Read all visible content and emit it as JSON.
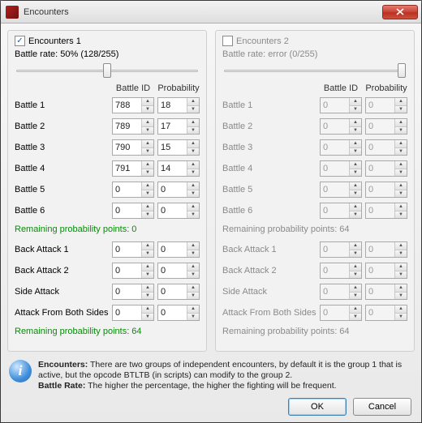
{
  "window": {
    "title": "Encounters"
  },
  "left": {
    "checkbox_label": "Encounters 1",
    "checked": true,
    "rate_label": "Battle rate: 50% (128/255)",
    "slider_percent": 50,
    "col_id": "Battle ID",
    "col_prob": "Probability",
    "battles": [
      {
        "label": "Battle 1",
        "id": "788",
        "prob": "18"
      },
      {
        "label": "Battle 2",
        "id": "789",
        "prob": "17"
      },
      {
        "label": "Battle 3",
        "id": "790",
        "prob": "15"
      },
      {
        "label": "Battle 4",
        "id": "791",
        "prob": "14"
      },
      {
        "label": "Battle 5",
        "id": "0",
        "prob": "0"
      },
      {
        "label": "Battle 6",
        "id": "0",
        "prob": "0"
      }
    ],
    "remaining1": "Remaining probability points: 0",
    "extras": [
      {
        "label": "Back Attack 1",
        "id": "0",
        "prob": "0"
      },
      {
        "label": "Back Attack 2",
        "id": "0",
        "prob": "0"
      },
      {
        "label": "Side Attack",
        "id": "0",
        "prob": "0"
      },
      {
        "label": "Attack From Both Sides",
        "id": "0",
        "prob": "0"
      }
    ],
    "remaining2": "Remaining probability points: 64"
  },
  "right": {
    "checkbox_label": "Encounters 2",
    "checked": false,
    "rate_label": "Battle rate: error (0/255)",
    "slider_percent": 100,
    "col_id": "Battle ID",
    "col_prob": "Probability",
    "battles": [
      {
        "label": "Battle 1",
        "id": "0",
        "prob": "0"
      },
      {
        "label": "Battle 2",
        "id": "0",
        "prob": "0"
      },
      {
        "label": "Battle 3",
        "id": "0",
        "prob": "0"
      },
      {
        "label": "Battle 4",
        "id": "0",
        "prob": "0"
      },
      {
        "label": "Battle 5",
        "id": "0",
        "prob": "0"
      },
      {
        "label": "Battle 6",
        "id": "0",
        "prob": "0"
      }
    ],
    "remaining1": "Remaining probability points: 64",
    "extras": [
      {
        "label": "Back Attack 1",
        "id": "0",
        "prob": "0"
      },
      {
        "label": "Back Attack 2",
        "id": "0",
        "prob": "0"
      },
      {
        "label": "Side Attack",
        "id": "0",
        "prob": "0"
      },
      {
        "label": "Attack From Both Sides",
        "id": "0",
        "prob": "0"
      }
    ],
    "remaining2": "Remaining probability points: 64"
  },
  "info": {
    "line1_bold": "Encounters:",
    "line1_rest": " There are two groups of independent encounters, by default it is the group 1 that is active, but the opcode BTLTB (in scripts) can modify to the group 2.",
    "line2_bold": "Battle Rate:",
    "line2_rest": " The higher the percentage, the higher the fighting will be frequent."
  },
  "buttons": {
    "ok": "OK",
    "cancel": "Cancel"
  }
}
